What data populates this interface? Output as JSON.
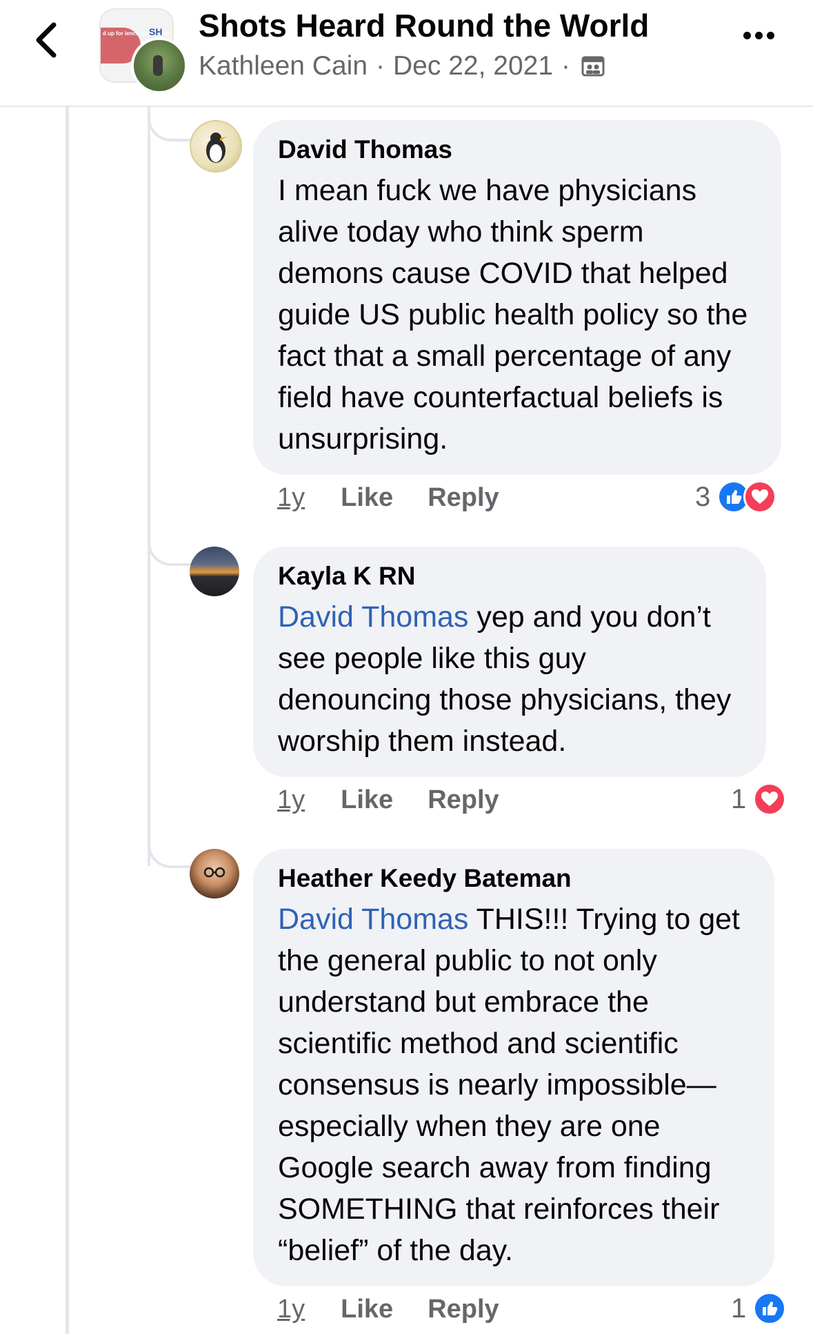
{
  "header": {
    "title": "Shots Heard Round the World",
    "author": "Kathleen Cain",
    "separator": "·",
    "date": "Dec 22, 2021",
    "avatar_banner_text": "d up for ience, up for you",
    "avatar_logo_text": "SH",
    "back_icon": "chevron-left-icon",
    "privacy_icon": "group-icon",
    "more_icon": "more-horizontal-icon"
  },
  "comments": [
    {
      "author": "David Thomas",
      "mention": "",
      "text": "I mean fuck we have physicians alive today who think sperm demons cause COVID that helped guide US public health policy so the fact that a small percentage of any field have counterfactual beliefs is unsurprising.",
      "time": "1y",
      "like_label": "Like",
      "reply_label": "Reply",
      "reaction_count": "3",
      "reactions": [
        "like",
        "love"
      ]
    },
    {
      "author": "Kayla K RN",
      "mention": "David Thomas",
      "text": " yep and you don’t see people like this guy denouncing those physicians, they worship them instead.",
      "time": "1y",
      "like_label": "Like",
      "reply_label": "Reply",
      "reaction_count": "1",
      "reactions": [
        "love"
      ]
    },
    {
      "author": "Heather Keedy Bateman",
      "mention": "David Thomas",
      "text": " THIS!!! Trying to get the general public to not only understand but embrace the scientific method and scientific consensus is nearly impossible—especially when they are one Google search away from  finding SOMETHING that reinforces their “belief” of the day.",
      "time": "1y",
      "like_label": "Like",
      "reply_label": "Reply",
      "reaction_count": "1",
      "reactions": [
        "like"
      ]
    }
  ],
  "colors": {
    "mention": "#2f62b5",
    "bubble": "#f0f2f5",
    "secondary_text": "#65676b",
    "like_reaction": "#1877f2",
    "love_reaction": "#f33e58"
  }
}
